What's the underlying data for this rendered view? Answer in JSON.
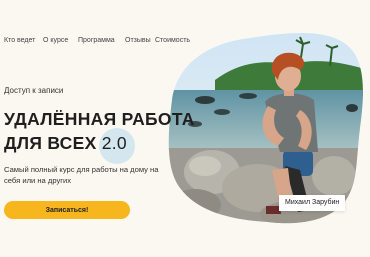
{
  "nav": [
    "Кто ведет",
    "О курсе",
    "Программа",
    "Отзывы",
    "Стоимость"
  ],
  "hero": {
    "eyebrow": "Доступ к записи",
    "title_line1": "УДАЛЁННАЯ РАБОТА",
    "title_line2_text": "ДЛЯ ВСЕХ",
    "title_line2_num": "2.0",
    "subtitle": "Самый полный курс для работы на дому на себя или на других",
    "cta_label": "Записаться!",
    "caption": "Михаил Зарубин"
  },
  "colors": {
    "background": "#fbf8f1",
    "accent_button": "#f7b61d",
    "accent_circle": "#d4e7ef"
  }
}
